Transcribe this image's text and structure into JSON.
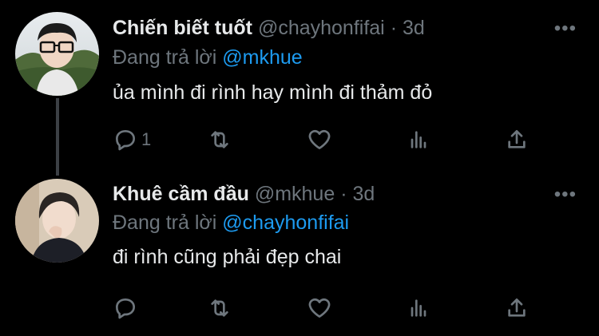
{
  "tweets": [
    {
      "name": "Chiến biết tuốt",
      "handle": "@chayhonfifai",
      "separator": "·",
      "time": "3d",
      "reply_prefix": "Đang trả lời",
      "reply_mention": "@mkhue",
      "text": "ủa mình đi rình hay mình đi thảm đỏ",
      "reply_count": "1",
      "more_icon": "more-horizontal-icon"
    },
    {
      "name": "Khuê cầm đầu",
      "handle": "@mkhue",
      "separator": "·",
      "time": "3d",
      "reply_prefix": "Đang trả lời",
      "reply_mention": "@chayhonfifai",
      "text": "đi rình cũng phải đẹp chai",
      "reply_count": "",
      "more_icon": "more-horizontal-icon"
    }
  ],
  "colors": {
    "background": "#000000",
    "text": "#e7e9ea",
    "secondary": "#6e767d",
    "accent": "#1d9bf0",
    "thread_line": "#3c4045"
  }
}
